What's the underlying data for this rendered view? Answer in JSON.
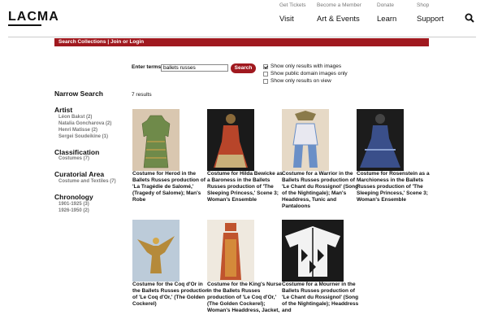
{
  "logo": "LACMA",
  "nav": [
    {
      "small": "Get Tickets",
      "main": "Visit"
    },
    {
      "small": "Become a Member",
      "main": "Art & Events"
    },
    {
      "small": "Donate",
      "main": "Learn"
    },
    {
      "small": "Shop",
      "main": "Support"
    }
  ],
  "breadcrumb": {
    "search": "Search Collections",
    "sep": " | ",
    "join": "Join or Login"
  },
  "search": {
    "label": "Enter terms",
    "value": "ballets russes",
    "button": "Search"
  },
  "options": [
    {
      "label": "Show only results with images",
      "checked": true
    },
    {
      "label": "Show public domain images only",
      "checked": false
    },
    {
      "label": "Show only results on view",
      "checked": false
    }
  ],
  "results_count": "7 results",
  "sidebar": {
    "title": "Narrow Search",
    "artist": {
      "title": "Artist",
      "items": [
        "Léon Bakst (2)",
        "Natalia Goncharova (2)",
        "Henri Matisse (2)",
        "Sergei Soudeikine (1)"
      ]
    },
    "classification": {
      "title": "Classification",
      "items": [
        "Costumes (7)"
      ]
    },
    "curatorial": {
      "title": "Curatorial Area",
      "items": [
        "Costume and Textiles (7)"
      ]
    },
    "chronology": {
      "title": "Chronology",
      "items": [
        "1901-1925 (3)",
        "1926-1950 (2)"
      ]
    }
  },
  "results": [
    {
      "caption": "Costume for Herod in the Ballets Russes production of 'La Tragédie de Salomé,' (Tragedy of Salome); Man's Robe",
      "bg": "#d9c7b0",
      "fg": "#6f8a4a"
    },
    {
      "caption": "Costume for Hilda Bewicke as a Baroness in the Ballets Russes production of 'The Sleeping Princess,' Scene 3; Woman's Ensemble",
      "bg": "#1a1a1a",
      "fg": "#b8452a"
    },
    {
      "caption": "Costume for a Warrior in the Ballets Russes production of 'Le Chant du Rossignol' (Song of the Nightingale); Man's Headdress, Tunic and Pantaloons",
      "bg": "#e6d9c6",
      "fg": "#6a8fc7"
    },
    {
      "caption": "Costume for Rosenstein as a Marchioness in the Ballets Russes production of 'The Sleeping Princess,' Scene 3; Woman's Ensemble",
      "bg": "#1c1c1c",
      "fg": "#3a4f8a"
    },
    {
      "caption": "Costume for the Coq d'Or in the Ballets Russes production of 'Le Coq d'Or,' (The Golden Cockerel)",
      "bg": "#bccbd9",
      "fg": "#b58a3a"
    },
    {
      "caption": "Costume for the King's Nurse in the Ballets Russes production of 'Le Coq d'Or,' (The Golden Cockerel); Woman's Headdress, Jacket,",
      "bg": "#efe9df",
      "fg": "#c0542e"
    },
    {
      "caption": "Costume for a Mourner in the Ballets Russes production of 'Le Chant du Rossignol' (Song of the Nightingale); Headdress and",
      "bg": "#1a1a1a",
      "fg": "#f2f2f2"
    }
  ]
}
